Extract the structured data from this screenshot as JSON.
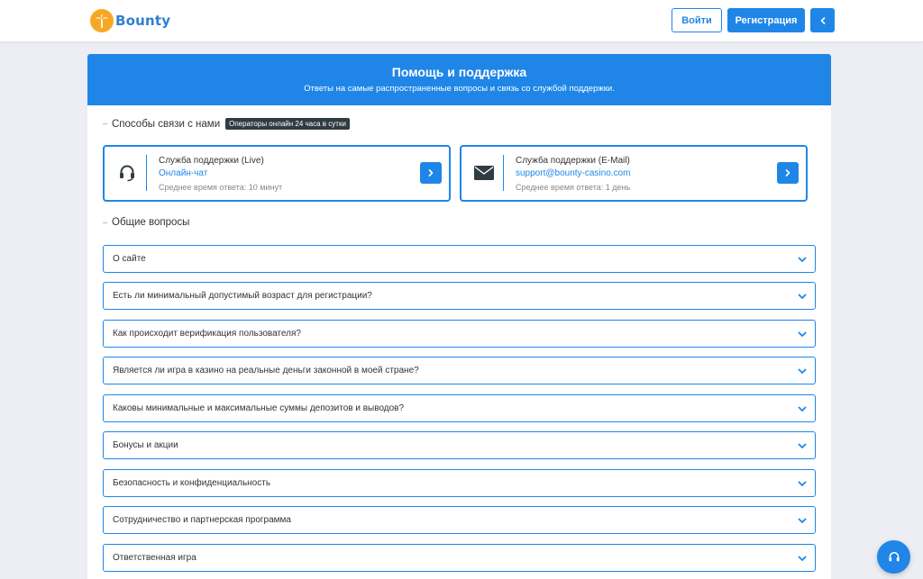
{
  "header": {
    "logo_text": "Bounty",
    "login_label": "Войти",
    "register_label": "Регистрация",
    "back_icon": "chevron-left-icon"
  },
  "hero": {
    "title": "Помощь и поддержка",
    "subtitle": "Ответы на самые распространенные вопросы и связь со службой поддержки."
  },
  "contacts": {
    "heading": "Способы связи с нами",
    "badge": "Операторы онлайн 24 часа в сутки",
    "cards": [
      {
        "icon": "headset-icon",
        "title": "Служба поддержки (Live)",
        "link": "Онлайн-чат",
        "meta": "Среднее время ответа: 10 минут"
      },
      {
        "icon": "envelope-icon",
        "title": "Служба поддержки (E-Mail)",
        "link": "support@bounty-casino.com",
        "meta": "Среднее время ответа: 1 день"
      }
    ]
  },
  "faq": {
    "heading": "Общие вопросы",
    "items": [
      "О сайте",
      "Есть ли минимальный допустимый возраст для регистрации?",
      "Как происходит верификация пользователя?",
      "Является ли игра в казино на реальные деньги законной в моей стране?",
      "Каковы минимальные и максимальные суммы депозитов и выводов?",
      "Бонусы и акции",
      "Безопасность и конфиденциальность",
      "Сотрудничество и партнерская программа",
      "Ответственная игра"
    ]
  },
  "colors": {
    "accent": "#1f86e8",
    "page_bg": "#eceef3",
    "badge_bg": "#2f3c42",
    "logo_mark": "#f7a823"
  }
}
